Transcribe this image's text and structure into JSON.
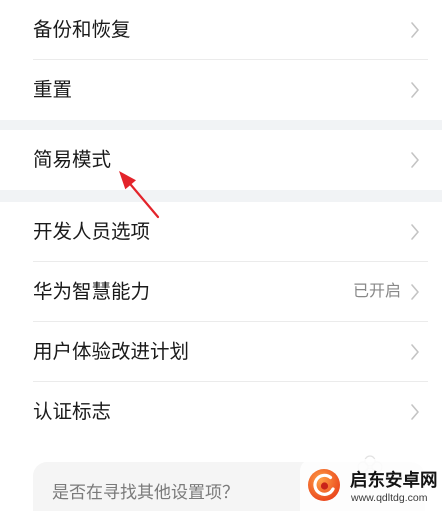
{
  "groups": [
    {
      "items": [
        {
          "label": "备份和恢复",
          "icon": "chevron-right-icon"
        },
        {
          "label": "重置",
          "icon": "chevron-right-icon"
        }
      ]
    },
    {
      "items": [
        {
          "label": "简易模式",
          "icon": "chevron-right-icon"
        }
      ]
    },
    {
      "items": [
        {
          "label": "开发人员选项",
          "icon": "chevron-right-icon"
        },
        {
          "label": "华为智慧能力",
          "value": "已开启",
          "icon": "chevron-right-icon"
        },
        {
          "label": "用户体验改进计划",
          "icon": "chevron-right-icon"
        },
        {
          "label": "认证标志",
          "icon": "chevron-right-icon"
        }
      ]
    }
  ],
  "suggestion_card": {
    "title": "是否在寻找其他设置项？",
    "decoration_icon": "flower-outline-icon"
  },
  "annotation": {
    "icon": "red-arrow-icon",
    "color": "#e3242b"
  },
  "watermark": {
    "name": "启东安卓网",
    "url": "www.qdltdg.com",
    "logo_icon": "qidong-anzhuo-logo-icon"
  },
  "colors": {
    "text": "#1a1a1a",
    "secondary_text": "#888888",
    "chevron": "#c4c4c4",
    "divider": "#ebebeb",
    "group_gap": "#f1f3f5",
    "card_background": "#f5f5f5",
    "card_text": "#7a7a7a",
    "annotation_red": "#e3242b",
    "watermark_orange": "#f0621f"
  }
}
